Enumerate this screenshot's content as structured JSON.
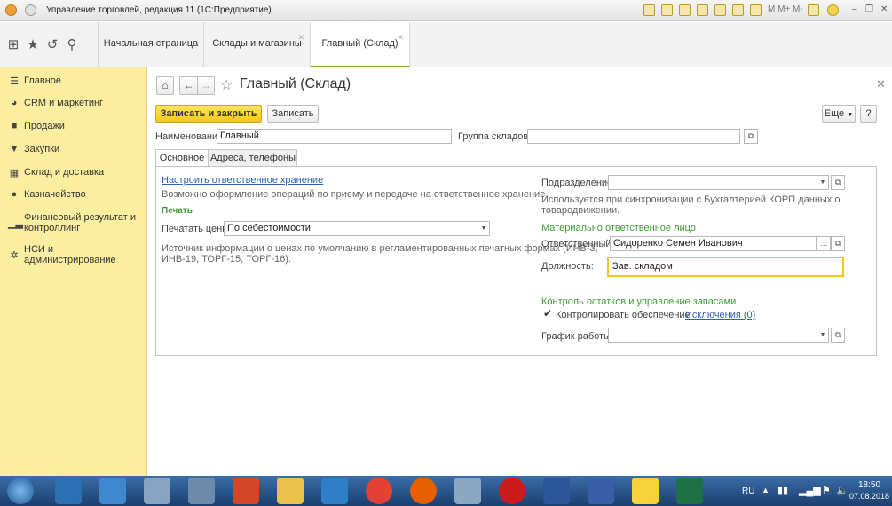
{
  "window": {
    "title": "Управление торговлей, редакция 11 (1С:Предприятие)",
    "toolbar_right": "M  M+ M-"
  },
  "tabs": [
    {
      "label": "Начальная страница"
    },
    {
      "label": "Склады и магазины"
    },
    {
      "label": "Главный (Склад)"
    }
  ],
  "sidebar": {
    "items": [
      {
        "label": "Главное",
        "icon": "menu-icon"
      },
      {
        "label": "CRM и маркетинг",
        "icon": "crm-icon"
      },
      {
        "label": "Продажи",
        "icon": "bag-icon"
      },
      {
        "label": "Закупки",
        "icon": "cart-icon"
      },
      {
        "label": "Склад и доставка",
        "icon": "warehouse-icon"
      },
      {
        "label": "Казначейство",
        "icon": "treasury-icon"
      },
      {
        "label": "Финансовый результат и контроллинг",
        "icon": "chart-icon"
      },
      {
        "label": "НСИ и администрирование",
        "icon": "gear-icon"
      }
    ]
  },
  "form": {
    "title": "Главный (Склад)",
    "save_close": "Записать и закрыть",
    "save": "Записать",
    "more": "Еще",
    "help": "?",
    "name_label": "Наименование:",
    "name_value": "Главный",
    "group_label": "Группа складов:",
    "group_value": "",
    "tab_main": "Основное",
    "tab_addr": "Адреса, телефоны",
    "left": {
      "storage_link": "Настроить ответственное хранение",
      "storage_hint": "Возможно оформление операций по приему и передаче на ответственное хранение.",
      "print_header": "Печать",
      "print_price_label": "Печатать цены:",
      "print_price_value": "По себестоимости",
      "price_hint_1": "Источник информации о ценах по умолчанию в регламентированных печатных формах (ИНВ-3,",
      "price_hint_2": "ИНВ-19, ТОРГ-15, ТОРГ-16)."
    },
    "right": {
      "division_label": "Подразделение:",
      "division_value": "",
      "division_hint": "Используется при синхронизации с Бухгалтерией КОРП данных о товародвижении.",
      "mol_header": "Материально ответственное лицо",
      "resp_label": "Ответственный:",
      "resp_value": "Сидоренко Семен Иванович",
      "position_label": "Должность:",
      "position_value": "Зав. складом",
      "stock_header": "Контроль остатков и управление запасами",
      "control_label": "Контролировать обеспечение",
      "exceptions_link": "Исключения (0)",
      "schedule_label": "График работы:",
      "schedule_value": ""
    }
  },
  "taskbar": {
    "lang": "RU",
    "time": "18:50",
    "date": "07.08.2018"
  }
}
